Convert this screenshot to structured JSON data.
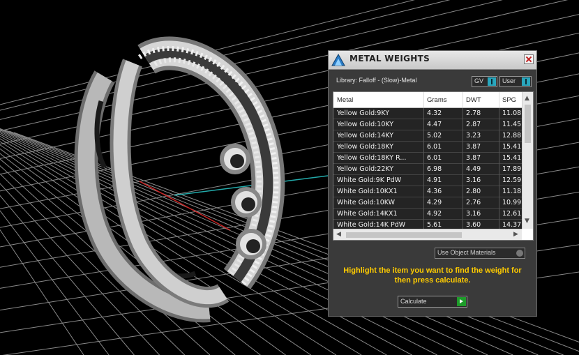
{
  "panel": {
    "title": "METAL WEIGHTS",
    "library_label": "Library: Falloff - (Slow)-Metal",
    "gv_label": "GV",
    "user_label": "User",
    "columns": [
      "Metal",
      "Grams",
      "DWT",
      "SPG"
    ],
    "rows": [
      {
        "metal": "Yellow Gold:9KY",
        "grams": "4.32",
        "dwt": "2.78",
        "spg": "11.08"
      },
      {
        "metal": "Yellow Gold:10KY",
        "grams": "4.47",
        "dwt": "2.87",
        "spg": "11.45"
      },
      {
        "metal": "Yellow Gold:14KY",
        "grams": "5.02",
        "dwt": "3.23",
        "spg": "12.88"
      },
      {
        "metal": "Yellow Gold:18KY",
        "grams": "6.01",
        "dwt": "3.87",
        "spg": "15.41"
      },
      {
        "metal": "Yellow Gold:18KY R...",
        "grams": "6.01",
        "dwt": "3.87",
        "spg": "15.41"
      },
      {
        "metal": "Yellow Gold:22KY",
        "grams": "6.98",
        "dwt": "4.49",
        "spg": "17.89"
      },
      {
        "metal": "White Gold:9K PdW",
        "grams": "4.91",
        "dwt": "3.16",
        "spg": "12.59"
      },
      {
        "metal": "White Gold:10KX1",
        "grams": "4.36",
        "dwt": "2.80",
        "spg": "11.18"
      },
      {
        "metal": "White Gold:10KW",
        "grams": "4.29",
        "dwt": "2.76",
        "spg": "10.99"
      },
      {
        "metal": "White Gold:14KX1",
        "grams": "4.92",
        "dwt": "3.16",
        "spg": "12.61"
      },
      {
        "metal": "White Gold:14K PdW",
        "grams": "5.61",
        "dwt": "3.60",
        "spg": "14.37"
      }
    ],
    "use_object_materials": "Use Object Materials",
    "instruction": "Highlight the item you want to find the weight for then press calculate.",
    "calculate_label": "Calculate"
  },
  "colors": {
    "instruction_text": "#ffcc00",
    "toggle_accent": "#29a6bd",
    "calculate_accent": "#1e9c2a",
    "grid": "#8a8a8a",
    "axis_x": "#cc2222",
    "axis_y": "#22aaaa"
  },
  "icons": {
    "app_logo": "app-logo-icon",
    "close": "close-icon"
  }
}
